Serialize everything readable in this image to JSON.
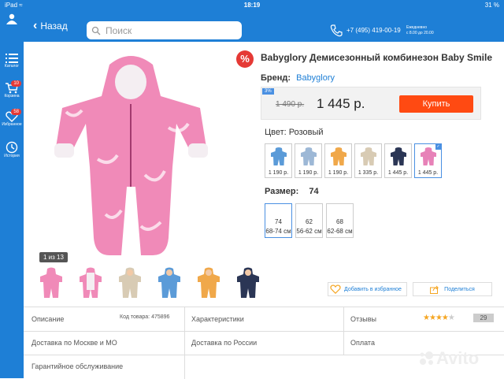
{
  "status": {
    "left": "iPad ≈",
    "time": "18:19",
    "battery": "31 %"
  },
  "header": {
    "back_label": "Назад",
    "search_placeholder": "Поиск",
    "phone": "+7 (495) 419-00-19",
    "hours": "Ежедневно\nс 8.00 до 20.00"
  },
  "sidebar": {
    "items": [
      {
        "label": "Каталог",
        "icon": "catalog-icon"
      },
      {
        "label": "Корзина",
        "icon": "cart-icon",
        "badge": "10"
      },
      {
        "label": "Избранное",
        "icon": "heart-icon",
        "badge": "58"
      },
      {
        "label": "История",
        "icon": "history-icon"
      }
    ]
  },
  "gallery": {
    "counter": "1 из 13"
  },
  "product": {
    "title": "Babyglory Демисезонный комбинезон Baby Smile",
    "brand_label": "Бренд:",
    "brand": "Babyglory",
    "discount": "3%",
    "old_price": "1 490 р.",
    "price": "1 445 р.",
    "buy_label": "Купить",
    "color_label": "Цвет: Розовый",
    "colors": [
      {
        "price": "1 190 р.",
        "hex": "#5b9bd8"
      },
      {
        "price": "1 190 р.",
        "hex": "#9db8d6"
      },
      {
        "price": "1 190 р.",
        "hex": "#f0a84a"
      },
      {
        "price": "1 335 р.",
        "hex": "#d8cbb4"
      },
      {
        "price": "1 445 р.",
        "hex": "#2b3655"
      },
      {
        "price": "1 445 р.",
        "hex": "#e782b8"
      }
    ],
    "size_label": "Размер:",
    "size_value": "74",
    "sizes": [
      {
        "size": "74",
        "range": "68-74 см"
      },
      {
        "size": "62",
        "range": "56-62 см"
      },
      {
        "size": "68",
        "range": "62-68 см"
      }
    ],
    "fav_label": "Добавить в избранное",
    "share_label": "Поделиться"
  },
  "info": {
    "description": "Описание",
    "code": "Код товара: 475896",
    "characteristics": "Характеристики",
    "reviews": "Отзывы",
    "rating": 4,
    "review_count": "29",
    "delivery_moscow": "Доставка по Москве и МО",
    "delivery_russia": "Доставка по России",
    "payment": "Оплата",
    "warranty": "Гарантийное обслуживание"
  },
  "watermark": "Avito",
  "colors": {
    "primary": "#1e7fd6",
    "buy": "#ff4a12",
    "sale": "#e53935",
    "product_pink": "#f08ab8"
  }
}
